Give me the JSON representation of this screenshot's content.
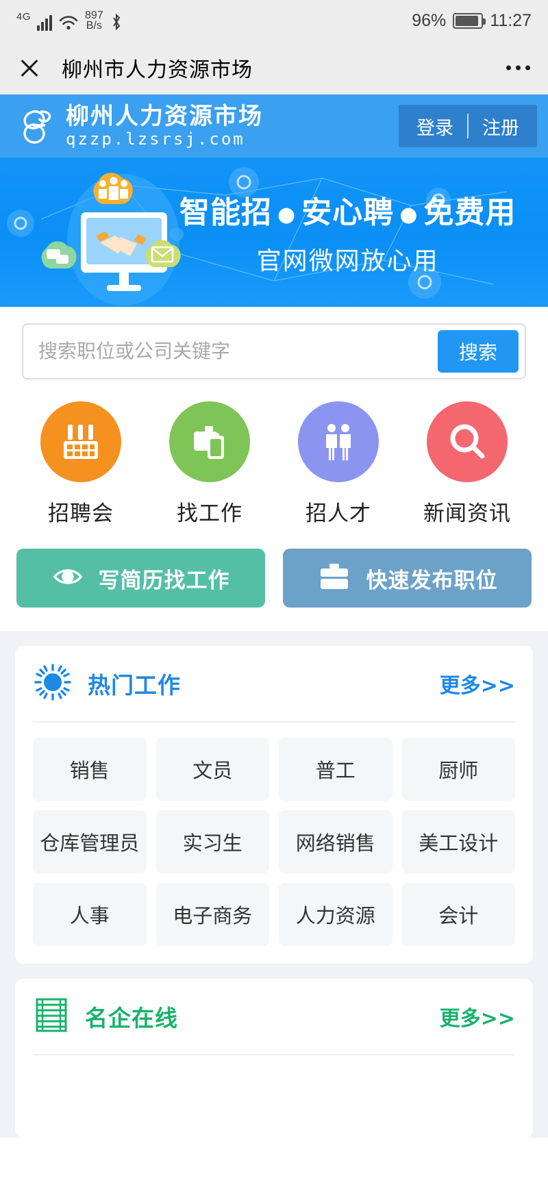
{
  "status_bar": {
    "network_type": "4G",
    "data_speed_value": "897",
    "data_speed_unit": "B/s",
    "battery_percent": "96%",
    "time": "11:27",
    "icons": [
      "signal-bars-icon",
      "wifi-icon",
      "bluetooth-icon",
      "battery-icon"
    ]
  },
  "nav_bar": {
    "close_icon": "close-icon",
    "title": "柳州市人力资源市场",
    "more_icon": "more-options-icon"
  },
  "site_header": {
    "logo_icon": "site-logo-icon",
    "brand_cn": "柳州人力资源市场",
    "brand_url": "qzzp.lzsrsj.com",
    "login_label": "登录",
    "register_label": "注册",
    "header_bg": "#3aa0ef",
    "auth_bg": "#2f80cc"
  },
  "banner": {
    "headline_parts": [
      "智能招",
      "安心聘",
      "免费用"
    ],
    "headline_separator": "●",
    "subline": "官网微网放心用",
    "bg_color": "#0b8ff5",
    "illustration": [
      "monitor-handshake-icon",
      "people-cloud-icon",
      "chat-cloud-icon",
      "mail-cloud-icon"
    ]
  },
  "search": {
    "placeholder": "搜索职位或公司关键字",
    "value": "",
    "button_label": "搜索",
    "button_color": "#2196f3"
  },
  "quick_nav": [
    {
      "label": "招聘会",
      "icon": "job-fair-booth-icon",
      "color": "#f5911e"
    },
    {
      "label": "找工作",
      "icon": "briefcase-resume-icon",
      "color": "#7fc457"
    },
    {
      "label": "招人才",
      "icon": "two-people-icon",
      "color": "#8b95ef"
    },
    {
      "label": "新闻资讯",
      "icon": "magnifier-icon",
      "color": "#f4676f"
    }
  ],
  "actions": [
    {
      "label": "写简历找工作",
      "icon": "eye-icon",
      "color": "#55bfa6"
    },
    {
      "label": "快速发布职位",
      "icon": "briefcase-icon",
      "color": "#6ca2c7"
    }
  ],
  "hot_jobs": {
    "icon": "sun-icon",
    "title": "热门工作",
    "more_label": "更多>>",
    "accent": "#1e88e5",
    "tags": [
      "销售",
      "文员",
      "普工",
      "厨师",
      "仓库管理员",
      "实习生",
      "网络销售",
      "美工设计",
      "人事",
      "电子商务",
      "人力资源",
      "会计"
    ]
  },
  "famous_firms": {
    "icon": "building-list-icon",
    "title": "名企在线",
    "more_label": "更多>>",
    "accent": "#18b26b"
  }
}
